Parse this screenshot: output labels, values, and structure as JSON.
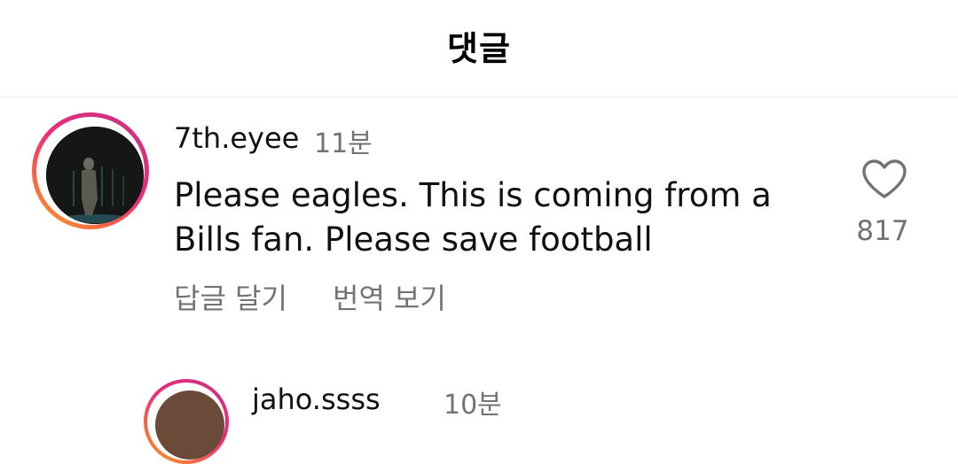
{
  "header": {
    "title": "댓글"
  },
  "comments": [
    {
      "username": "7th.eyee",
      "time": "11분",
      "text": "Please eagles. This is coming from a Bills fan. Please save football",
      "reply_label": "답글 달기",
      "translate_label": "번역 보기",
      "like_icon": "heart-outline-icon",
      "like_count": "817"
    },
    {
      "username": "jaho.ssss",
      "time": "10분"
    }
  ],
  "colors": {
    "text_primary": "#111111",
    "text_secondary": "#737373",
    "story_ring_start": "#f9a11b",
    "story_ring_end": "#c13584",
    "divider": "#ededed"
  }
}
